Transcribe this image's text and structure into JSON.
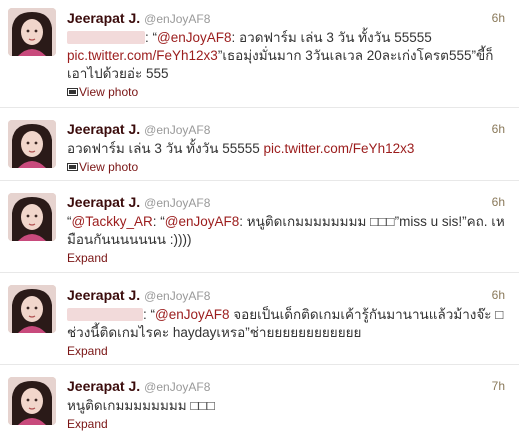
{
  "tweets": [
    {
      "fullname": "Jeerapat J.",
      "username": "@enJoyAF8",
      "time": "6h",
      "text_parts": [
        {
          "kind": "redact"
        },
        {
          "kind": "text",
          "value": ": “"
        },
        {
          "kind": "link",
          "value": "@enJoyAF8"
        },
        {
          "kind": "text",
          "value": ": อวดฟาร์ม เล่น 3 วัน ทั้งวัน 55555 "
        },
        {
          "kind": "link",
          "value": "pic.twitter.com/FeYh12x3"
        },
        {
          "kind": "text",
          "value": "”เธอมุ่งมั่นมาก 3วันเลเวล 20ละเก่งโครต555”ขี้ก็เอาไปด้วยอ่ะ 555"
        }
      ],
      "action": "View photo",
      "action_icon": "photo-icon"
    },
    {
      "fullname": "Jeerapat J.",
      "username": "@enJoyAF8",
      "time": "6h",
      "text_parts": [
        {
          "kind": "text",
          "value": "อวดฟาร์ม เล่น 3 วัน ทั้งวัน 55555 "
        },
        {
          "kind": "link",
          "value": "pic.twitter.com/FeYh12x3"
        }
      ],
      "action": "View photo",
      "action_icon": "photo-icon"
    },
    {
      "fullname": "Jeerapat J.",
      "username": "@enJoyAF8",
      "time": "6h",
      "text_parts": [
        {
          "kind": "text",
          "value": "“"
        },
        {
          "kind": "link",
          "value": "@Tackky_AR"
        },
        {
          "kind": "text",
          "value": ": “"
        },
        {
          "kind": "link",
          "value": "@enJoyAF8"
        },
        {
          "kind": "text",
          "value": ": หนูติดเกมมมมมมมม □□□”miss u sis!”คถ. เหมือนกันนนนนนน :))))"
        }
      ],
      "action": "Expand",
      "action_icon": ""
    },
    {
      "fullname": "Jeerapat J.",
      "username": "@enJoyAF8",
      "time": "6h",
      "text_parts": [
        {
          "kind": "redact"
        },
        {
          "kind": "text",
          "value": ": “"
        },
        {
          "kind": "link",
          "value": "@enJoyAF8"
        },
        {
          "kind": "text",
          "value": " จอยเป็นเด็กติดเกมเค้ารู้กันมานานแล้วม้างจ๊ะ □ ช่วงนี้ติดเกมไรคะ haydayเหรอ”ช่ายยยยยยยยยยยย"
        }
      ],
      "action": "Expand",
      "action_icon": ""
    },
    {
      "fullname": "Jeerapat J.",
      "username": "@enJoyAF8",
      "time": "7h",
      "text_parts": [
        {
          "kind": "text",
          "value": "หนูติดเกมมมมมมมม □□□"
        }
      ],
      "action": "Expand",
      "action_icon": ""
    }
  ],
  "colors": {
    "fullname": "#3b0c0c",
    "link": "#9b1c1c",
    "action": "#7a1515",
    "muted": "#999999"
  }
}
